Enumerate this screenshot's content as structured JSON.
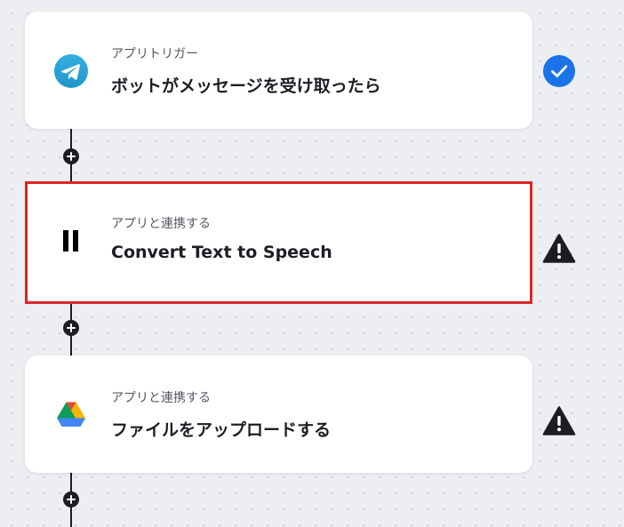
{
  "flow": {
    "steps": [
      {
        "subtitle": "アプリトリガー",
        "title": "ボットがメッセージを受け取ったら",
        "app_icon": "telegram-icon",
        "status_icon": "check-circle-icon",
        "status": "complete"
      },
      {
        "subtitle": "アプリと連携する",
        "title": "Convert Text to Speech",
        "app_icon": "pause-icon",
        "status_icon": "warning-icon",
        "status": "warning",
        "selected": true
      },
      {
        "subtitle": "アプリと連携する",
        "title": "ファイルをアップロードする",
        "app_icon": "google-drive-icon",
        "status_icon": "warning-icon",
        "status": "warning"
      }
    ]
  },
  "colors": {
    "background": "#edeef2",
    "card": "#ffffff",
    "selected_border": "#dc2626",
    "success": "#1a73e8",
    "warning": "#1b1d22",
    "telegram": "#2aa3df"
  }
}
